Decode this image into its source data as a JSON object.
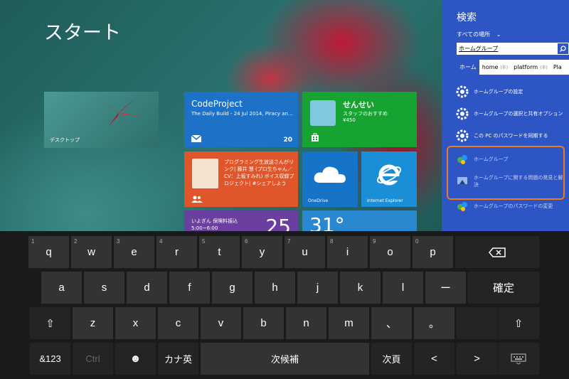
{
  "start": {
    "title": "スタート",
    "tiles": {
      "desktop": {
        "label": "デスクトップ"
      },
      "mail": {
        "title": "CodeProject",
        "subtitle": "The Daily Build - 24 Jul 2014, Piracy an…",
        "count": "20"
      },
      "store": {
        "title": "せんせい",
        "line1": "スタッフのおすすめ",
        "line2": "¥450"
      },
      "people": {
        "text": "プログラミング生放送さんがリンク| 藤井 慧 (プロ生ちゃん／CV：上坂すみれ) ボイス収録プロジェクト| #シェアしよう"
      },
      "onedrive": {
        "label": "OneDrive"
      },
      "ie": {
        "label": "Internet Explorer"
      },
      "calendar": {
        "line1": "いよぎん 保険料振込",
        "line2": "5:00~6:00",
        "day": "25"
      },
      "weather": {
        "temp": "31°"
      }
    }
  },
  "search": {
    "title": "検索",
    "scope": "すべての場所",
    "query": "ホームグループ",
    "candidates": [
      {
        "text": "ホーム",
        "tag": ""
      },
      {
        "text": "home",
        "tag": "(半)"
      },
      {
        "text": "platform",
        "tag": "(半)"
      },
      {
        "text": "Pla",
        "tag": ""
      }
    ],
    "results": [
      {
        "text": "ホームグループの設定"
      },
      {
        "text": "ホームグループの選択と共有オプション"
      },
      {
        "text": "この PC のパスワードを同期する"
      },
      {
        "text": "ホームグループ"
      },
      {
        "text": "ホームグループに関する問題の発見と解決"
      },
      {
        "text": "ホームグループのパスワードの変更"
      }
    ],
    "highlight_color": "#f07a1c"
  },
  "keyboard": {
    "row1": [
      {
        "k": "q",
        "s": "1"
      },
      {
        "k": "w",
        "s": "2"
      },
      {
        "k": "e",
        "s": "3"
      },
      {
        "k": "r",
        "s": "4"
      },
      {
        "k": "t",
        "s": "5"
      },
      {
        "k": "y",
        "s": "6"
      },
      {
        "k": "u",
        "s": "7"
      },
      {
        "k": "i",
        "s": "8"
      },
      {
        "k": "o",
        "s": "9"
      },
      {
        "k": "p",
        "s": "0"
      }
    ],
    "backspace": "⌫",
    "row2": [
      "a",
      "s",
      "d",
      "f",
      "g",
      "h",
      "j",
      "k",
      "l",
      "ー"
    ],
    "enter": "確定",
    "shift": "⇧",
    "row3": [
      "z",
      "x",
      "c",
      "v",
      "b",
      "n",
      "m",
      "、",
      "。"
    ],
    "shift_right": "⇧",
    "bottom": {
      "num": "&123",
      "ctrl": "Ctrl",
      "emoji": "☻",
      "kana": "カナ英",
      "space": "次候補",
      "next_page": "次頁",
      "arrow_left": "<",
      "arrow_right": ">",
      "keyboard_icon": "keyboard-icon"
    }
  },
  "colors": {
    "charm": "#2d55c4",
    "key": "#333333"
  }
}
